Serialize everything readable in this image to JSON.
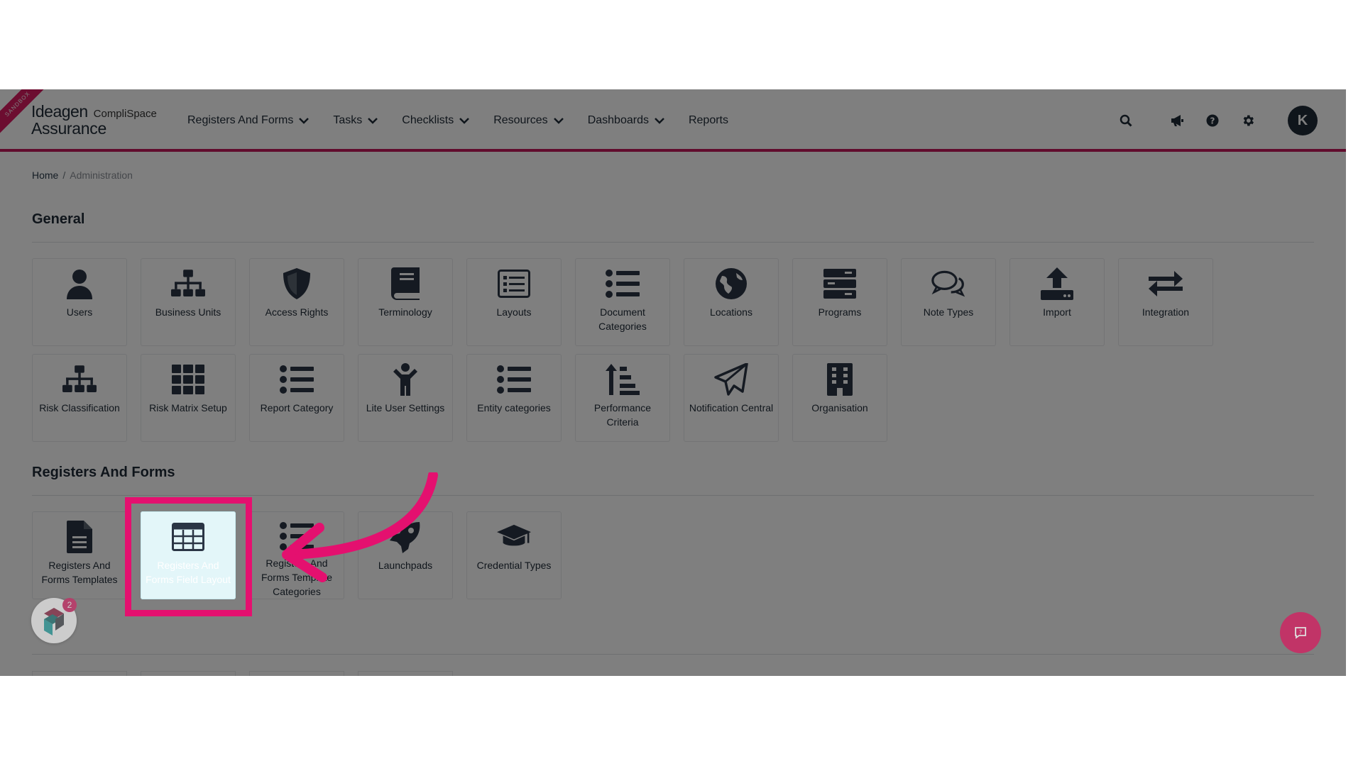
{
  "header": {
    "ribbon": "SANDBOX",
    "logo_ideagen": "Ideagen",
    "logo_complispace": "CompliSpace",
    "logo_assurance": "Assurance",
    "nav": [
      {
        "label": "Registers And Forms",
        "dropdown": true
      },
      {
        "label": "Tasks",
        "dropdown": true
      },
      {
        "label": "Checklists",
        "dropdown": true
      },
      {
        "label": "Resources",
        "dropdown": true
      },
      {
        "label": "Dashboards",
        "dropdown": true
      },
      {
        "label": "Reports",
        "dropdown": false
      }
    ],
    "avatar_initial": "K",
    "icons": [
      "search-icon",
      "megaphone-icon",
      "help-icon",
      "gear-icon"
    ]
  },
  "breadcrumb": {
    "home": "Home",
    "current": "Administration"
  },
  "sections": [
    {
      "title": "General",
      "tiles": [
        {
          "label": "Users",
          "icon": "user-icon"
        },
        {
          "label": "Business Units",
          "icon": "sitemap-icon"
        },
        {
          "label": "Access Rights",
          "icon": "shield-icon"
        },
        {
          "label": "Terminology",
          "icon": "book-icon"
        },
        {
          "label": "Layouts",
          "icon": "list-box-icon"
        },
        {
          "label": "Document Categories",
          "icon": "list-icon"
        },
        {
          "label": "Locations",
          "icon": "globe-icon"
        },
        {
          "label": "Programs",
          "icon": "server-icon"
        },
        {
          "label": "Note Types",
          "icon": "comments-icon"
        },
        {
          "label": "Import",
          "icon": "upload-icon"
        },
        {
          "label": "Integration",
          "icon": "exchange-icon"
        },
        {
          "label": "Risk Classification",
          "icon": "sitemap-icon"
        },
        {
          "label": "Risk Matrix Setup",
          "icon": "grid-icon"
        },
        {
          "label": "Report Category",
          "icon": "list-icon"
        },
        {
          "label": "Lite User Settings",
          "icon": "child-icon"
        },
        {
          "label": "Entity categories",
          "icon": "list-icon"
        },
        {
          "label": "Performance Criteria",
          "icon": "sort-amount-icon"
        },
        {
          "label": "Notification Central",
          "icon": "paper-plane-icon"
        },
        {
          "label": "Organisation",
          "icon": "building-icon"
        }
      ]
    },
    {
      "title": "Registers And Forms",
      "tiles": [
        {
          "label": "Registers And Forms Templates",
          "icon": "file-icon"
        },
        {
          "label": "Registers And Forms Field Layout",
          "icon": "table-icon",
          "highlighted": true
        },
        {
          "label": "Registers And Forms Template Categories",
          "icon": "list-icon"
        },
        {
          "label": "Launchpads",
          "icon": "rocket-icon"
        },
        {
          "label": "Credential Types",
          "icon": "graduation-cap-icon"
        }
      ]
    }
  ],
  "widget": {
    "badge": "2"
  },
  "colors": {
    "accent": "#d81b60",
    "annotation": "#e4106f",
    "text": "#1f2a37",
    "highlight_tile": "#e3f6f9"
  }
}
